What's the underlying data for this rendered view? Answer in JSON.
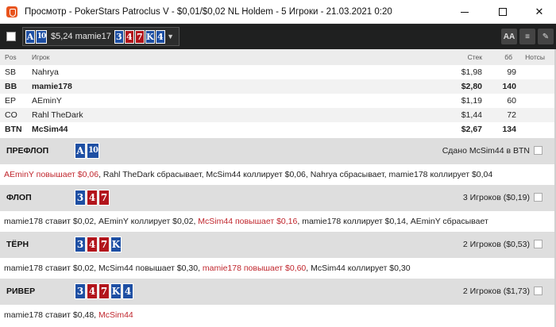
{
  "window": {
    "title": "Просмотр - PokerStars Patroclus V - $0,01/$0,02 NL Holdem - 5 Игроки - 21.03.2021 0:20"
  },
  "toolbar": {
    "hand_cards": [
      {
        "rank": "A",
        "color": "blue"
      },
      {
        "rank": "10",
        "color": "blue"
      }
    ],
    "hand_text": "$5,24 mamie17",
    "board_cards": [
      {
        "rank": "3",
        "color": "blue"
      },
      {
        "rank": "4",
        "color": "red"
      },
      {
        "rank": "7",
        "color": "red"
      },
      {
        "rank": "K",
        "color": "blue"
      },
      {
        "rank": "4",
        "color": "blue"
      }
    ],
    "buttons": [
      {
        "label": "AA",
        "icon": "font-size-icon"
      },
      {
        "label": "≡",
        "icon": "list-icon"
      },
      {
        "label": "✎",
        "icon": "pencil-icon"
      }
    ]
  },
  "players_table": {
    "headers": {
      "pos": "Pos",
      "player": "Игрок",
      "stack": "Стек",
      "bb": "бб",
      "notes": "Нотсы"
    },
    "rows": [
      {
        "pos": "SB",
        "name": "Nahrya",
        "stack": "$1,98",
        "bb": "99",
        "bold": false
      },
      {
        "pos": "BB",
        "name": "mamie178",
        "stack": "$2,80",
        "bb": "140",
        "bold": true
      },
      {
        "pos": "EP",
        "name": "AEminY",
        "stack": "$1,19",
        "bb": "60",
        "bold": false
      },
      {
        "pos": "CO",
        "name": "Rahl TheDark",
        "stack": "$1,44",
        "bb": "72",
        "bold": false
      },
      {
        "pos": "BTN",
        "name": "McSim44",
        "stack": "$2,67",
        "bb": "134",
        "bold": true
      }
    ]
  },
  "streets": [
    {
      "label": "ПРЕФЛОП",
      "cards": [
        {
          "rank": "A",
          "color": "blue"
        },
        {
          "rank": "10",
          "color": "blue"
        }
      ],
      "pot": "Сдано McSim44 в BTN",
      "actions": [
        {
          "text": "AEminY повышает $0,06",
          "red": true
        },
        {
          "text": ", Rahl TheDark сбрасывает, McSim44 коллирует $0,06, Nahrya сбрасывает, mamie178 коллирует $0,04",
          "red": false
        }
      ]
    },
    {
      "label": "ФЛОП",
      "cards": [
        {
          "rank": "3",
          "color": "blue"
        },
        {
          "rank": "4",
          "color": "red"
        },
        {
          "rank": "7",
          "color": "red"
        }
      ],
      "pot": "3 Игроков ($0,19)",
      "actions": [
        {
          "text": "mamie178 ставит $0,02, AEminY коллирует $0,02, ",
          "red": false
        },
        {
          "text": "McSim44 повышает $0,16",
          "red": true
        },
        {
          "text": ", mamie178 коллирует $0,14, AEminY сбрасывает",
          "red": false
        }
      ]
    },
    {
      "label": "ТЁРН",
      "cards": [
        {
          "rank": "3",
          "color": "blue"
        },
        {
          "rank": "4",
          "color": "red"
        },
        {
          "rank": "7",
          "color": "red"
        },
        {
          "rank": "K",
          "color": "blue"
        }
      ],
      "pot": "2 Игроков ($0,53)",
      "actions": [
        {
          "text": "mamie178 ставит $0,02, McSim44 повышает $0,30, ",
          "red": false
        },
        {
          "text": "mamie178 повышает $0,60",
          "red": true
        },
        {
          "text": ", McSim44 коллирует $0,30",
          "red": false
        }
      ]
    },
    {
      "label": "РИВЕР",
      "cards": [
        {
          "rank": "3",
          "color": "blue"
        },
        {
          "rank": "4",
          "color": "red"
        },
        {
          "rank": "7",
          "color": "red"
        },
        {
          "rank": "K",
          "color": "blue"
        },
        {
          "rank": "4",
          "color": "blue"
        }
      ],
      "pot": "2 Игроков ($1,73)",
      "actions": [
        {
          "text": "mamie178 ставит $0,48, ",
          "red": false
        },
        {
          "text": "McSim44",
          "red": true
        }
      ]
    }
  ]
}
